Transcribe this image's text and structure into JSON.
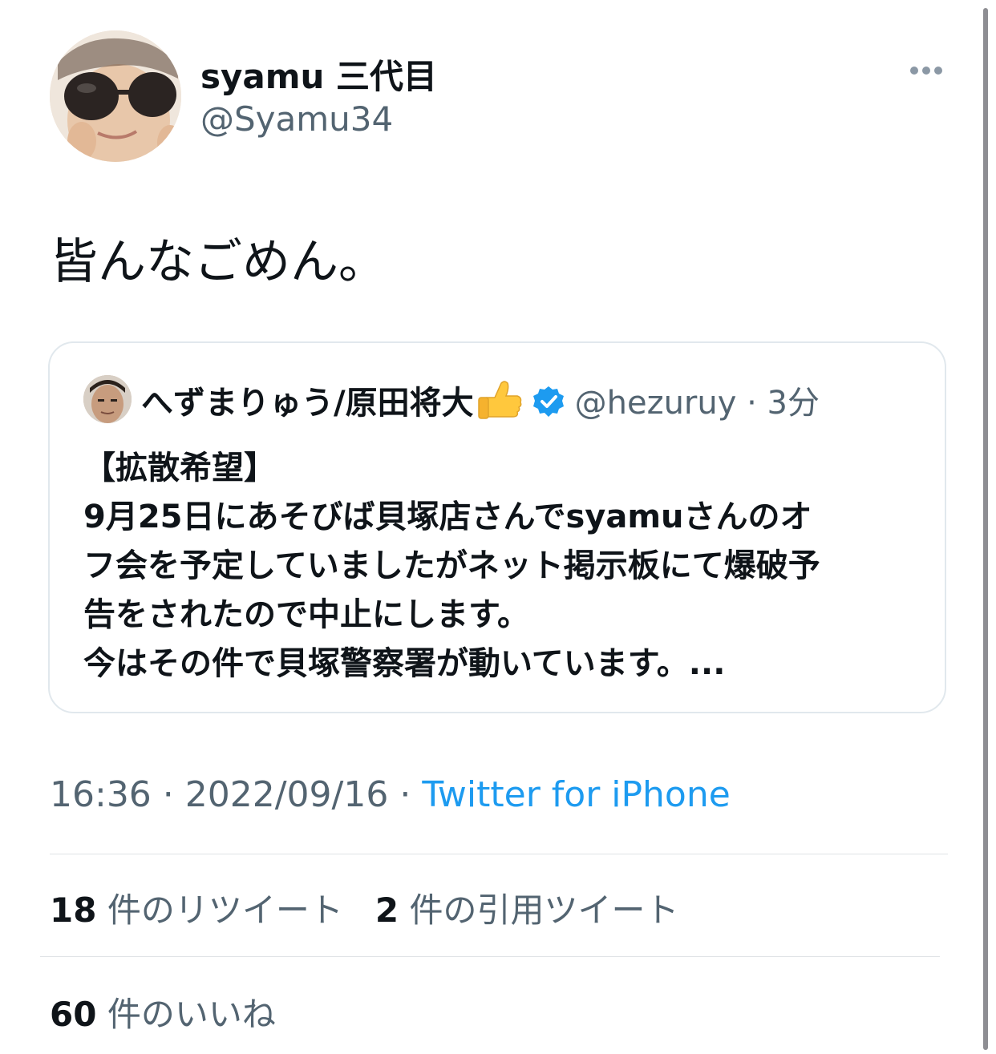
{
  "author": {
    "display_name": "syamu 三代目",
    "handle": "@Syamu34"
  },
  "tweet": {
    "text": "皆んなごめん。",
    "timestamp": "16:36 · 2022/09/16 · ",
    "source": "Twitter for iPhone"
  },
  "quoted_tweet": {
    "name": "へずまりゅう/原田将大",
    "handle": "@hezuruy",
    "separator": "·",
    "time": "3分",
    "lines": [
      "【拡散希望】",
      "9月25日にあそびば貝塚店さんでsyamuさんのオ",
      "フ会を予定していましたがネット掲示板にて爆破予",
      "告をされたので中止にします。",
      "今はその件で貝塚警察署が動いています。..."
    ]
  },
  "stats": {
    "retweets_count": "18",
    "retweets_label": "件のリツイート",
    "quotes_count": "2",
    "quotes_label": "件の引用ツイート",
    "likes_count": "60",
    "likes_label": "件のいいね"
  },
  "icons": {
    "more": "more-horizontal-icon",
    "verified": "verified-badge-icon",
    "emoji": "thumbs-up-emoji"
  },
  "colors": {
    "accent": "#1d9bf0",
    "secondary_text": "#536471",
    "primary_text": "#0f1419"
  }
}
